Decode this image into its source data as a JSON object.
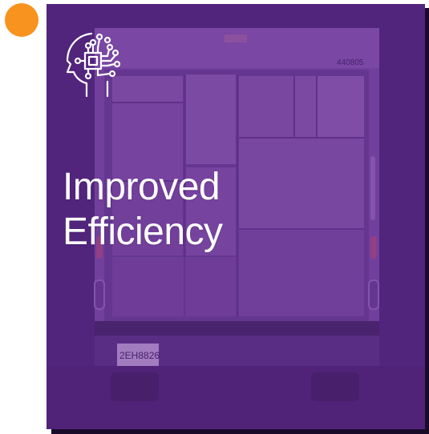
{
  "card": {
    "title_line1": "Improved",
    "title_line2": "Efficiency",
    "icon": "ai-head-circuit-icon",
    "truck_number": "440805",
    "plate_text": "2EH8826"
  },
  "colors": {
    "accent_dot": "#f7931e",
    "overlay": "#5b2a86",
    "text": "#ffffff"
  }
}
